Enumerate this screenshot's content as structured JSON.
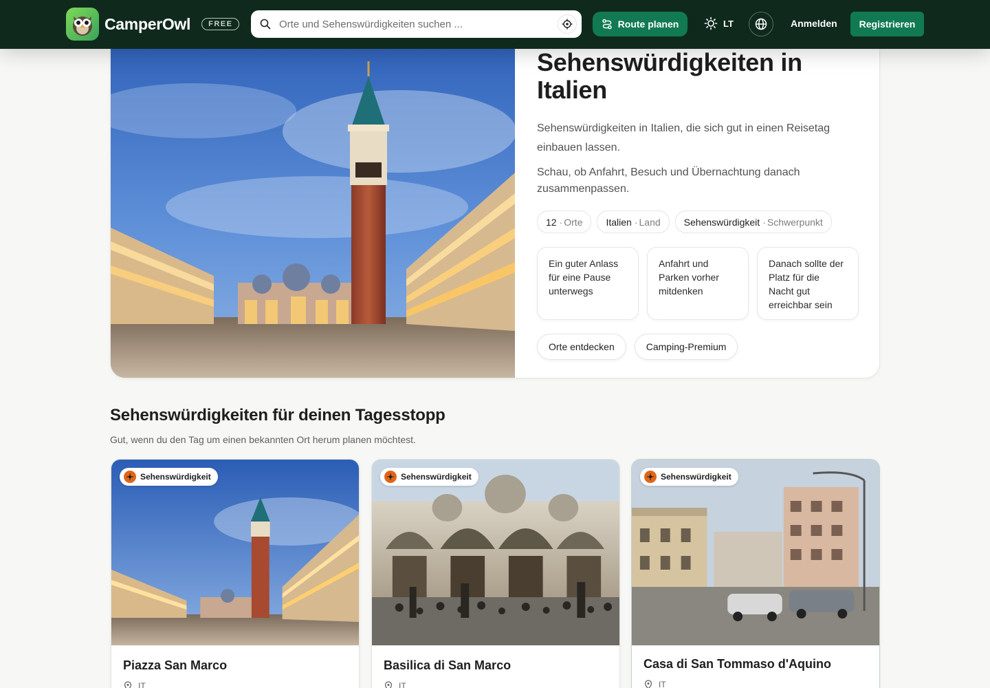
{
  "header": {
    "brand": "CamperOwl",
    "plan_badge": "FREE",
    "search_placeholder": "Orte und Sehenswürdigkeiten suchen ...",
    "route_button": "Route planen",
    "theme_label": "LT",
    "login": "Anmelden",
    "register": "Registrieren"
  },
  "hero": {
    "title": "Sehenswürdigkeiten in Italien",
    "description": "Sehenswürdigkeiten in Italien, die sich gut in einen Reisetag einbauen lassen.",
    "description2": "Schau, ob Anfahrt, Besuch und Übernachtung danach zusammenpassen.",
    "chips": [
      {
        "value": "12",
        "label": "Orte"
      },
      {
        "value": "Italien",
        "label": "Land"
      },
      {
        "value": "Sehenswürdigkeit",
        "label": "Schwerpunkt"
      }
    ],
    "tips": [
      "Ein guter Anlass für eine Pause unterwegs",
      "Anfahrt und Parken vorher mitdenken",
      "Danach sollte der Platz für die Nacht gut erreichbar sein"
    ],
    "actions": [
      "Orte entdecken",
      "Camping-Premium"
    ]
  },
  "section": {
    "title": "Sehenswürdigkeiten für deinen Tagesstopp",
    "subtitle": "Gut, wenn du den Tag um einen bekannten Ort herum planen möchtest."
  },
  "cards": [
    {
      "badge": "Sehenswürdigkeit",
      "title": "Piazza San Marco",
      "country": "IT"
    },
    {
      "badge": "Sehenswürdigkeit",
      "title": "Basilica di San Marco",
      "country": "IT"
    },
    {
      "badge": "Sehenswürdigkeit",
      "title": "Casa di San Tommaso d'Aquino",
      "country": "IT"
    }
  ],
  "colors": {
    "nav_bg": "#0f2a1d",
    "accent": "#117a52",
    "badge_icon": "#e0651a"
  },
  "icons": [
    "owl-logo-icon",
    "search-icon",
    "locate-icon",
    "route-icon",
    "sun-icon",
    "globe-icon",
    "pin-icon",
    "attraction-icon"
  ]
}
